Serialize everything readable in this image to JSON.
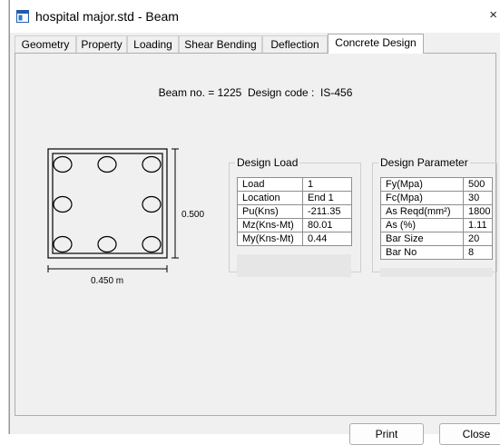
{
  "window": {
    "title": "hospital major.std - Beam",
    "close_glyph": "×"
  },
  "tabs": [
    {
      "label": "Geometry"
    },
    {
      "label": "Property"
    },
    {
      "label": "Loading"
    },
    {
      "label": "Shear Bending"
    },
    {
      "label": "Deflection"
    },
    {
      "label": "Concrete Design",
      "active": true
    }
  ],
  "header": {
    "beam_label": "Beam no. = 1225",
    "design_code_label": "Design code :  IS-456"
  },
  "section": {
    "height_label": "0.500",
    "width_label": "0.450 m",
    "bar_count": 8
  },
  "design_load": {
    "title": "Design Load",
    "rows": [
      {
        "label": "Load",
        "value": "1"
      },
      {
        "label": "Location",
        "value": "End 1"
      },
      {
        "label": "Pu(Kns)",
        "value": "-211.35"
      },
      {
        "label": "Mz(Kns-Mt)",
        "value": "80.01"
      },
      {
        "label": "My(Kns-Mt)",
        "value": "0.44"
      }
    ]
  },
  "design_parameter": {
    "title": "Design Parameter",
    "rows": [
      {
        "label": "Fy(Mpa)",
        "value": "500"
      },
      {
        "label": "Fc(Mpa)",
        "value": "30"
      },
      {
        "label": "As Reqd(mm²)",
        "value": "1800"
      },
      {
        "label": "As (%)",
        "value": "1.11"
      },
      {
        "label": "Bar Size",
        "value": "20"
      },
      {
        "label": "Bar No",
        "value": "8"
      }
    ]
  },
  "buttons": {
    "print": "Print",
    "close": "Close"
  },
  "colors": {
    "window_bg": "#f0f0f0",
    "panel_bg": "#f0f0f0",
    "title_bg": "#ffffff"
  }
}
